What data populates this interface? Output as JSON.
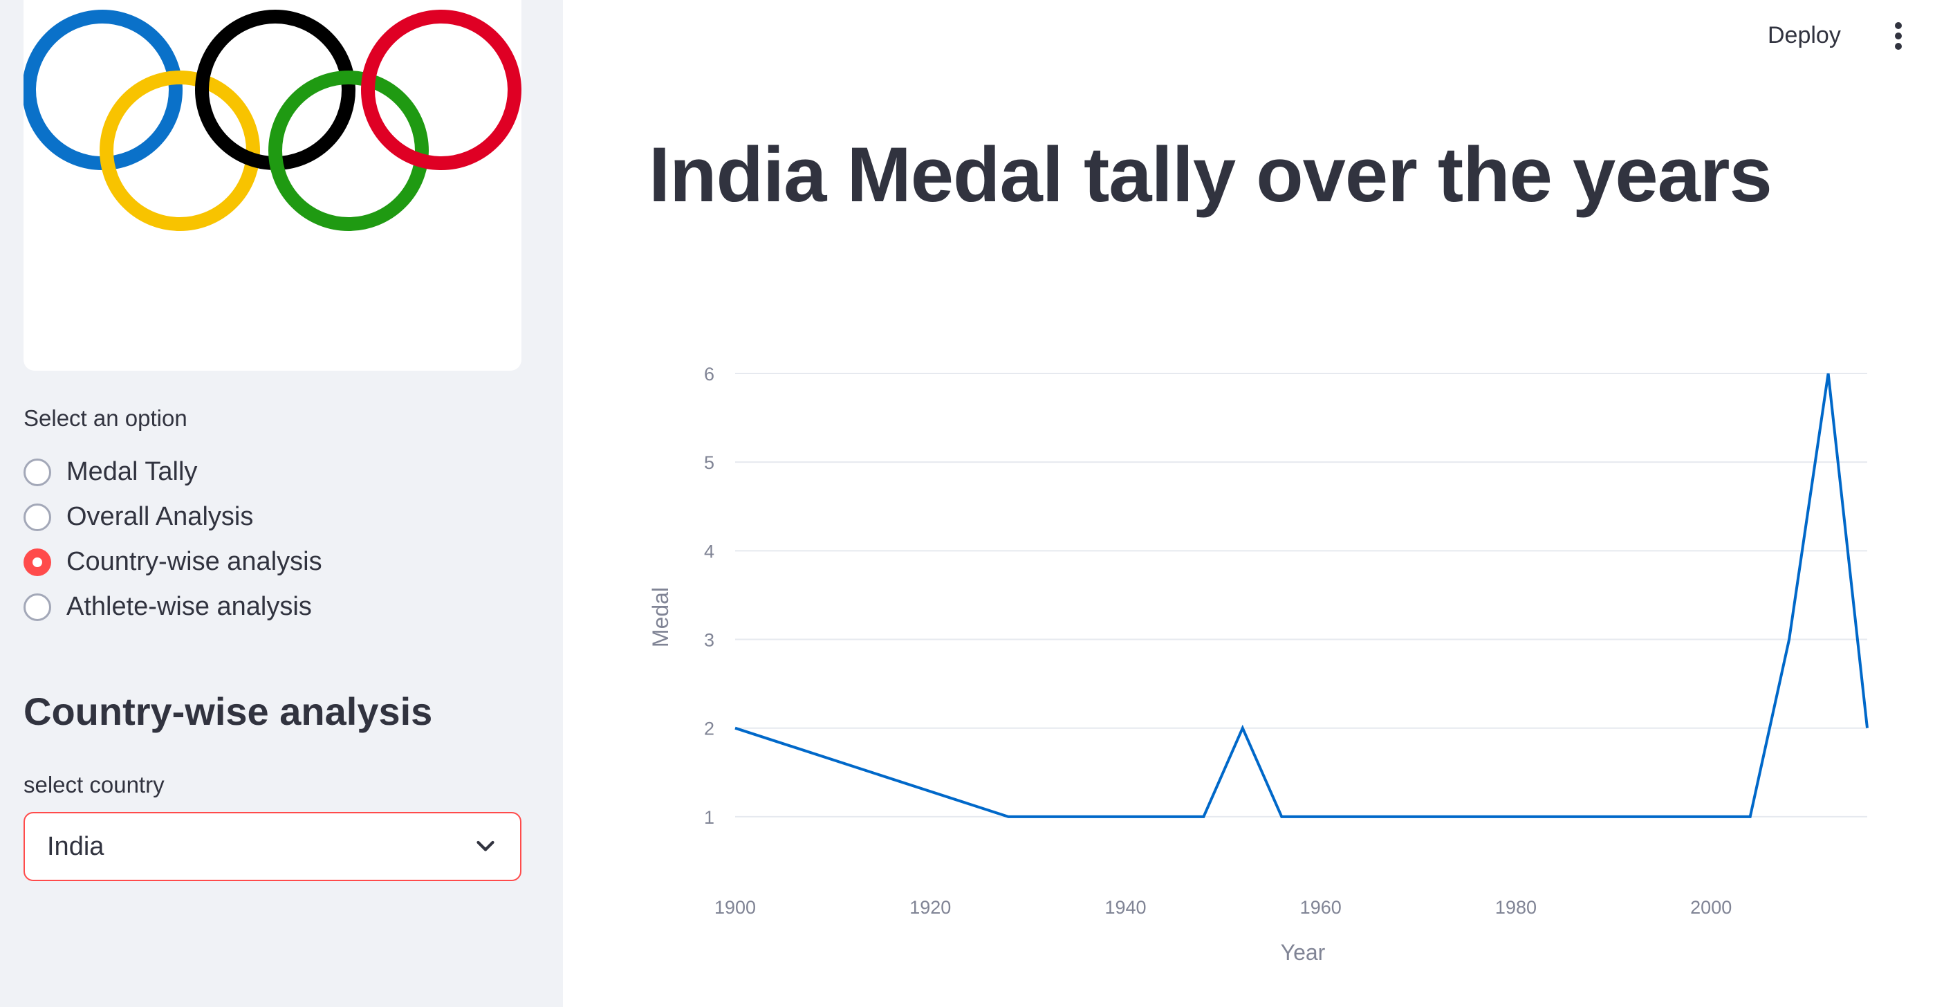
{
  "header": {
    "deploy_label": "Deploy",
    "menu_icon": "vertical-dots-icon"
  },
  "sidebar": {
    "logo_icon": "olympic-rings-logo",
    "logo_colors": [
      "#0a71c9",
      "#f8c300",
      "#000000",
      "#1f9a12",
      "#df0024"
    ],
    "radio_label": "Select an option",
    "options": [
      {
        "label": "Medal Tally",
        "selected": false
      },
      {
        "label": "Overall Analysis",
        "selected": false
      },
      {
        "label": "Country-wise analysis",
        "selected": true
      },
      {
        "label": "Athlete-wise analysis",
        "selected": false
      }
    ],
    "section_heading": "Country-wise analysis",
    "select_label": "select country",
    "select_value": "India",
    "accent_color": "#ff4b4b"
  },
  "main": {
    "title": "India Medal tally over the years"
  },
  "chart_data": {
    "type": "line",
    "xlabel": "Year",
    "ylabel": "Medal",
    "x_ticks": [
      1900,
      1920,
      1940,
      1960,
      1980,
      2000
    ],
    "y_ticks": [
      1,
      2,
      3,
      4,
      5,
      6
    ],
    "xlim": [
      1900,
      2016
    ],
    "ylim": [
      0.5,
      6
    ],
    "grid": true,
    "line_color": "#0068c9",
    "x": [
      1900,
      1928,
      1932,
      1936,
      1948,
      1952,
      1956,
      1960,
      1964,
      1968,
      1972,
      1980,
      1984,
      1988,
      1992,
      1996,
      2000,
      2004,
      2008,
      2012,
      2016
    ],
    "y": [
      2,
      1,
      1,
      1,
      1,
      2,
      1,
      1,
      1,
      1,
      1,
      1,
      1,
      1,
      1,
      1,
      1,
      1,
      3,
      6,
      2
    ]
  }
}
